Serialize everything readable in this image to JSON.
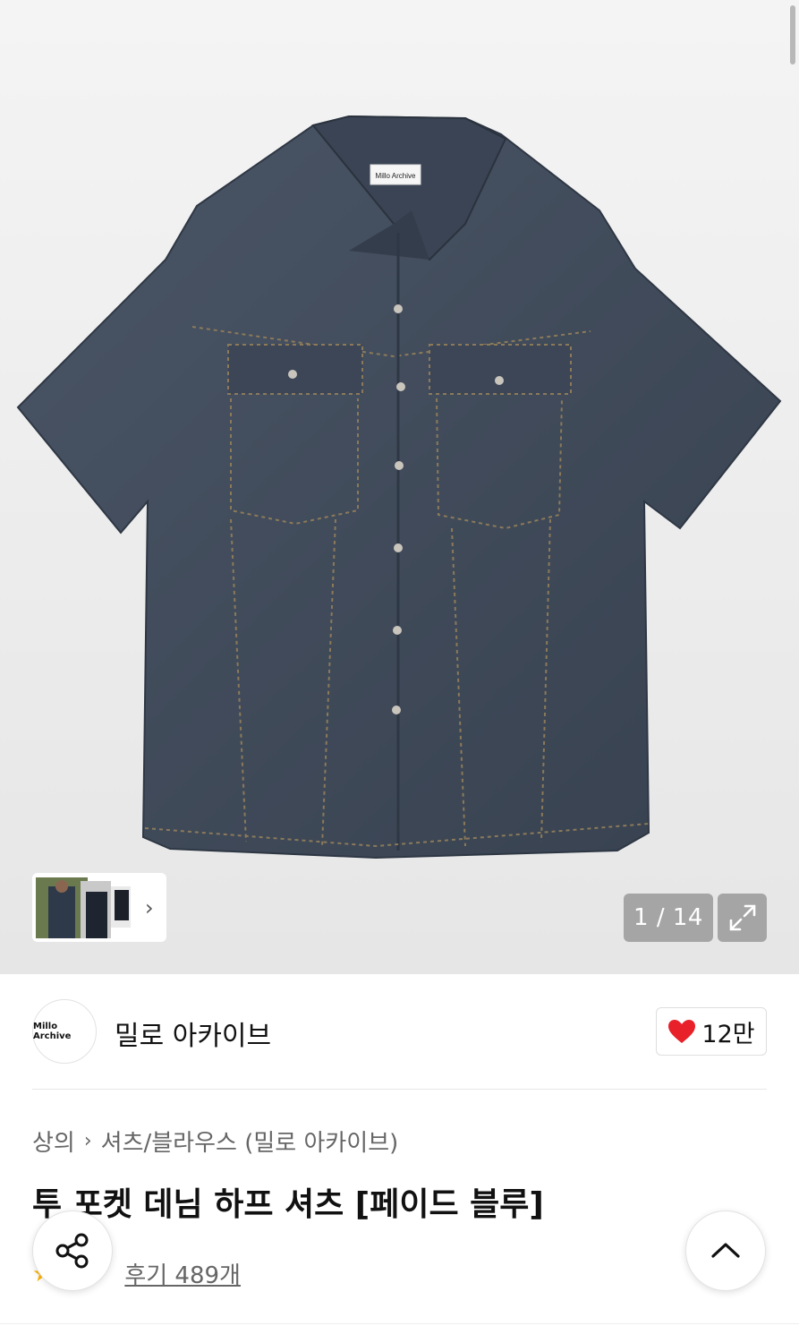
{
  "gallery": {
    "tag_label": "Millo Archive",
    "counter": "1 / 14",
    "icons": {
      "next": "chevron-right-icon",
      "expand": "expand-icon"
    }
  },
  "brand": {
    "logo_text": "Millo Archive",
    "name": "밀로 아카이브",
    "likes": "12만",
    "like_color": "#e8202a"
  },
  "breadcrumb": {
    "category": "상의",
    "subcategory": "셔츠/블라우스 (밀로 아카이브)"
  },
  "product": {
    "title": "투 포켓 데님 하프 셔츠 [페이드 블루]",
    "review_label": "후기 489개"
  },
  "fabs": {
    "share": "share-icon",
    "top": "chevron-up-icon"
  },
  "colors": {
    "denim": "#3f4a5a",
    "star": "#ffb400"
  }
}
